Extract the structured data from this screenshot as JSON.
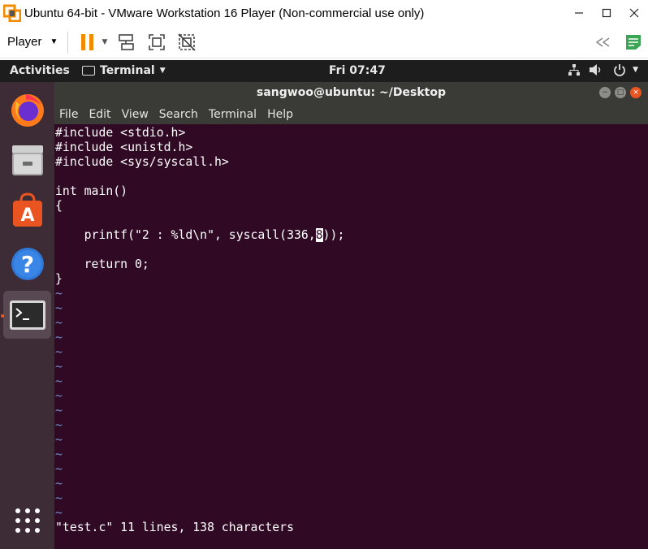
{
  "window": {
    "title": "Ubuntu 64-bit - VMware Workstation 16 Player (Non-commercial use only)"
  },
  "toolbar": {
    "player_label": "Player"
  },
  "topbar": {
    "activities": "Activities",
    "app_name": "Terminal",
    "clock": "Fri 07:47"
  },
  "dock": {
    "items": [
      "firefox-icon",
      "files-icon",
      "software-center-icon",
      "help-icon",
      "terminal-icon",
      "show-apps-icon"
    ],
    "active_item": "terminal-icon"
  },
  "terminal": {
    "title": "sangwoo@ubuntu: ~/Desktop",
    "menu": [
      "File",
      "Edit",
      "View",
      "Search",
      "Terminal",
      "Help"
    ],
    "code_lines": [
      "#include <stdio.h>",
      "#include <unistd.h>",
      "#include <sys/syscall.h>",
      "",
      "int main()",
      "{",
      "",
      "    printf(\"2 : %ld\\n\", syscall(336,",
      "",
      "    return 0;",
      "}"
    ],
    "cursor_char": "8",
    "cursor_after": "));",
    "tilde": "~",
    "tilde_count": 16,
    "status": "\"test.c\" 11 lines, 138 characters"
  },
  "colors": {
    "terminal_bg": "#300a24",
    "dock_bg": "#3d2b35",
    "accent_orange": "#e95420",
    "vmware_orange": "#f38b00",
    "vmware_green": "#3aa655"
  }
}
